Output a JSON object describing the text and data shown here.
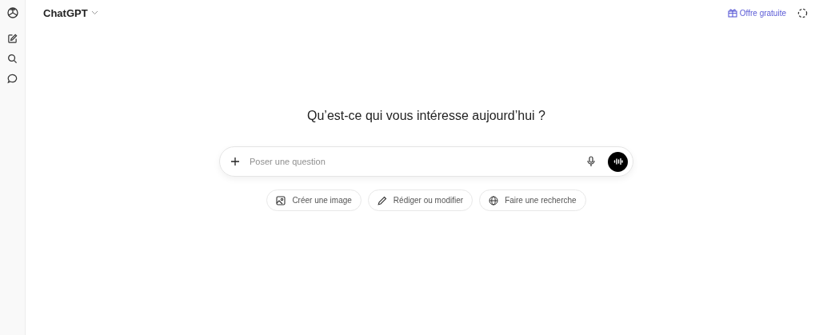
{
  "header": {
    "model": "ChatGPT",
    "offer": "Offre gratuite"
  },
  "heading": "Qu’est-ce qui vous intéresse aujourd’hui ?",
  "composer": {
    "placeholder": "Poser une question"
  },
  "suggestions": [
    {
      "label": "Créer une image"
    },
    {
      "label": "Rédiger ou modifier"
    },
    {
      "label": "Faire une recherche"
    }
  ]
}
